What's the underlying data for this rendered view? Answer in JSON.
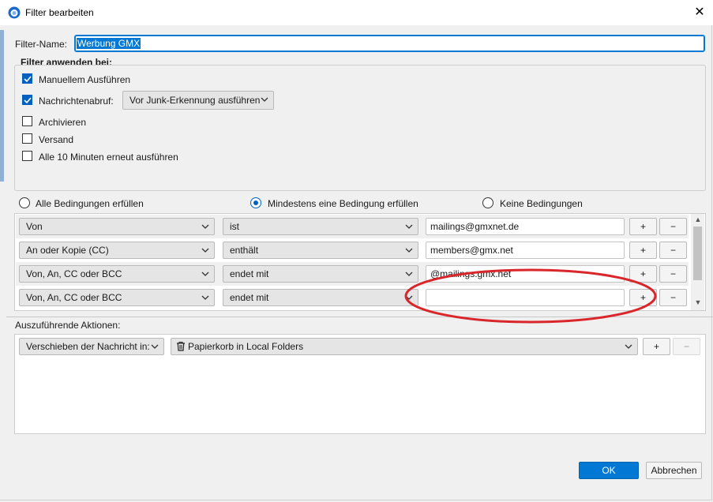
{
  "window": {
    "title": "Filter bearbeiten",
    "close_glyph": "✕"
  },
  "filter_name": {
    "label": "Filter-Name:",
    "value": "Werbung GMX"
  },
  "apply_when": {
    "legend": "Filter anwenden bei:",
    "manual": {
      "label": "Manuellem Ausführen",
      "checked": true
    },
    "fetch": {
      "label": "Nachrichtenabruf:",
      "checked": true,
      "option": "Vor Junk-Erkennung ausführen"
    },
    "archive": {
      "label": "Archivieren",
      "checked": false
    },
    "send": {
      "label": "Versand",
      "checked": false
    },
    "periodic": {
      "label": "Alle 10 Minuten erneut ausführen",
      "checked": false
    }
  },
  "match_mode": {
    "all": "Alle Bedingungen erfüllen",
    "any": "Mindestens eine Bedingung erfüllen",
    "none": "Keine Bedingungen",
    "selected": "any"
  },
  "conditions": [
    {
      "field": "Von",
      "operator": "ist",
      "value": "mailings@gmxnet.de"
    },
    {
      "field": "An oder Kopie (CC)",
      "operator": "enthält",
      "value": "members@gmx.net"
    },
    {
      "field": "Von, An, CC oder BCC",
      "operator": "endet mit",
      "value": "@mailings.gmx.net"
    },
    {
      "field": "Von, An, CC oder BCC",
      "operator": "endet mit",
      "value": ""
    }
  ],
  "row_buttons": {
    "add": "+",
    "remove": "−"
  },
  "actions": {
    "legend": "Auszuführende Aktionen:",
    "items": [
      {
        "action": "Verschieben der Nachricht in:",
        "target": "Papierkorb in Local Folders"
      }
    ],
    "add": "+",
    "remove": "−"
  },
  "buttons": {
    "ok": "OK",
    "cancel": "Abbrechen"
  },
  "colors": {
    "accent": "#0078d4",
    "annotation": "#d9262b"
  }
}
